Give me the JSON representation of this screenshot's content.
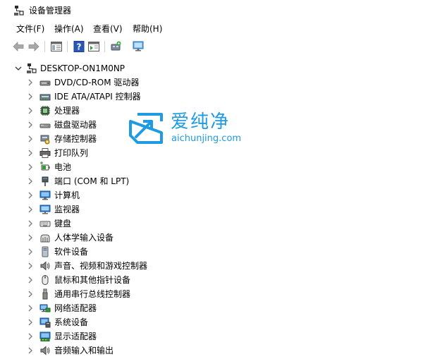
{
  "window": {
    "title": "设备管理器",
    "icon": "device-manager-icon"
  },
  "menu": [
    "文件(F)",
    "操作(A)",
    "查看(V)",
    "帮助(H)"
  ],
  "toolbar": {
    "buttons": [
      "back-arrow-icon",
      "forward-arrow-icon",
      "show-hide-console-tree-icon",
      "help-icon",
      "action-pane-icon",
      "scan-hardware-icon",
      "monitor-icon"
    ]
  },
  "tree": {
    "root": {
      "label": "DESKTOP-ON1M0NP",
      "icon": "computer-tree-icon",
      "expanded": true
    },
    "items": [
      {
        "label": "DVD/CD-ROM 驱动器",
        "icon": "dvd-drive-icon"
      },
      {
        "label": "IDE ATA/ATAPI 控制器",
        "icon": "ide-controller-icon"
      },
      {
        "label": "处理器",
        "icon": "processor-icon"
      },
      {
        "label": "磁盘驱动器",
        "icon": "disk-drive-icon"
      },
      {
        "label": "存储控制器",
        "icon": "storage-controller-icon"
      },
      {
        "label": "打印队列",
        "icon": "printer-icon"
      },
      {
        "label": "电池",
        "icon": "battery-icon"
      },
      {
        "label": "端口 (COM 和 LPT)",
        "icon": "port-icon"
      },
      {
        "label": "计算机",
        "icon": "computer-icon"
      },
      {
        "label": "监视器",
        "icon": "monitor-icon"
      },
      {
        "label": "键盘",
        "icon": "keyboard-icon"
      },
      {
        "label": "人体学输入设备",
        "icon": "hid-icon"
      },
      {
        "label": "软件设备",
        "icon": "software-device-icon"
      },
      {
        "label": "声音、视频和游戏控制器",
        "icon": "speaker-icon"
      },
      {
        "label": "鼠标和其他指针设备",
        "icon": "mouse-icon"
      },
      {
        "label": "通用串行总线控制器",
        "icon": "usb-icon"
      },
      {
        "label": "网络适配器",
        "icon": "network-adapter-icon"
      },
      {
        "label": "系统设备",
        "icon": "system-device-icon"
      },
      {
        "label": "显示适配器",
        "icon": "display-adapter-icon"
      },
      {
        "label": "音频输入和输出",
        "icon": "audio-io-icon"
      }
    ]
  },
  "watermark": {
    "text_cn": "爱纯净",
    "text_en": "aichunjing.com",
    "color": "#1e9be3"
  },
  "colors": {
    "icon_blue": "#2b79d6",
    "chevron": "#7a7a7a"
  }
}
